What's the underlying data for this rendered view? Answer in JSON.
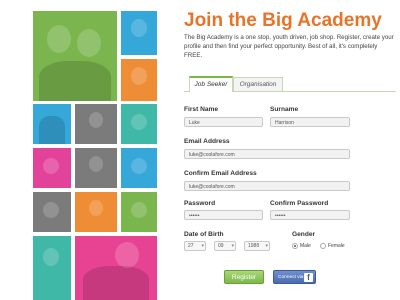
{
  "mosaic_colors": {
    "green": "#7bb54e",
    "blue": "#35a7d9",
    "orange": "#ee8d36",
    "grey": "#7b7b7b",
    "magenta": "#e2429a",
    "teal": "#3fb8a8",
    "pink": "#e84393"
  },
  "header": {
    "title": "Join the Big Academy",
    "intro": "The Big Academy is a one stop, youth driven, job shop. Register, create your profile and then find your perfect opportunity. Best of all, it's completely FREE."
  },
  "tabs": [
    {
      "label": "Job Seeker",
      "active": true
    },
    {
      "label": "Organisation",
      "active": false
    }
  ],
  "form": {
    "first_name_label": "First Name",
    "first_name_value": "Luke",
    "surname_label": "Surname",
    "surname_value": "Harrison",
    "email_label": "Email Address",
    "email_value": "luke@coolafore.com",
    "confirm_email_label": "Confirm Email Address",
    "confirm_email_value": "luke@coolafore.com",
    "password_label": "Password",
    "password_value": "••••••",
    "confirm_password_label": "Confirm Password",
    "confirm_password_value": "••••••",
    "dob_label": "Date of Birth",
    "dob_day": "27",
    "dob_month": "09",
    "dob_year": "1988",
    "gender_label": "Gender",
    "gender_male": "Male",
    "gender_female": "Female",
    "gender_selected": "Male"
  },
  "buttons": {
    "register": "Register",
    "connect": "Connect via"
  },
  "facebook_glyph": "f"
}
